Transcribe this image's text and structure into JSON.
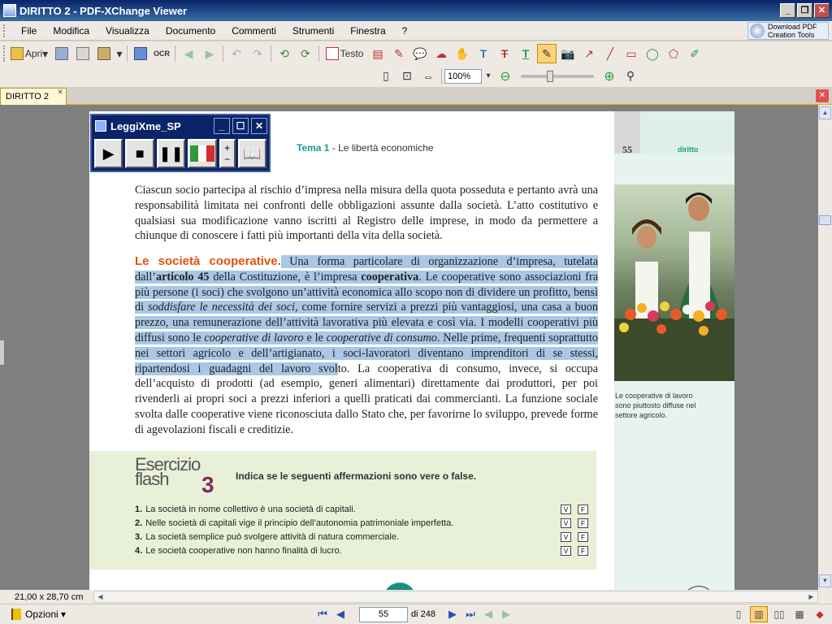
{
  "window": {
    "title": "DIRITTO 2 - PDF-XChange Viewer"
  },
  "menu": [
    "File",
    "Modifica",
    "Visualizza",
    "Documento",
    "Commenti",
    "Strumenti",
    "Finestra",
    "?"
  ],
  "download_tools": {
    "line1": "Download PDF",
    "line2": "Creation Tools"
  },
  "toolbar": {
    "open_label": "Apri",
    "text_label": "Testo",
    "ocr_label": "OCR",
    "zoom_value": "100%"
  },
  "tab": {
    "label": "DIRITTO 2",
    "close": "✕"
  },
  "leggixme": {
    "title": "LeggiXme_SP"
  },
  "page": {
    "header_tema": "Tema 1",
    "header_rest": " - Le libertà economiche",
    "number": "55",
    "subject": "diritto",
    "para1": "Ciascun socio partecipa al rischio d’impresa nella misura della quota posseduta e pertanto avrà una responsabilità limitata nei confronti delle obbligazioni assunte dalla società. L’atto costitutivo e qualsiasi sua modificazione vanno iscritti al Registro delle imprese, in modo da permettere a chiunque di conoscere i fatti più importanti della vita della società.",
    "section_title": "Le società cooperative.",
    "hl_a": " Una forma particolare di organizzazione d’impresa, tutelata dall’",
    "hl_b": "articolo 45",
    "hl_c": " della Costituzione, è l’impresa ",
    "hl_d": "cooperativa",
    "hl_e": ". Le cooperative sono associazioni fra più persone (i soci) che svolgono un’attività economica allo scopo non di dividere un profitto, bensì di ",
    "hl_f": "soddisfare le necessità dei soci",
    "hl_g": ", come fornire servizi a prezzi più vantaggiosi, una casa a buon prezzo, una remunerazione dell’attività lavorativa più elevata e così via. I modelli cooperativi più diffusi sono le ",
    "hl_h": "cooperative di lavoro",
    "hl_i": " e le ",
    "hl_j": "cooperative di consumo",
    "hl_k": ". Nelle prime, frequenti soprattutto nei settori agricolo e dell’artigianato, i soci-lavoratori diventano imprenditori di se stessi, ripartendosi i guadagni del lavoro svol",
    "rest": "to. La cooperativa di consumo, invece, si occupa dell’acquisto di prodotti (ad esempio, generi alimentari) direttamente dai produttori, per poi rivenderli ai propri soci a prezzi inferiori a quelli praticati dai commercianti. La funzione sociale svolta dalle cooperative viene riconosciuta dallo Stato che, per favorirne lo sviluppo, prevede forme di agevolazioni fiscali e creditizie.",
    "caption": "Le cooperative di lavoro sono piuttosto diffuse nel settore agricolo."
  },
  "exercise": {
    "title_line1": "Esercizio",
    "title_line2": "flash",
    "number": "3",
    "instruction": "Indica se le seguenti affermazioni sono vere o false.",
    "items": [
      {
        "n": "1.",
        "text": "La società in nome collettivo è una società di capitali."
      },
      {
        "n": "2.",
        "text": "Nelle società di capitali vige il principio dell’autonomia patrimoniale imperfetta."
      },
      {
        "n": "3.",
        "text": "La società semplice può svolgere attività di natura commerciale."
      },
      {
        "n": "4.",
        "text": "Le società cooperative non hanno finalità di lucro."
      }
    ],
    "v": "V",
    "f": "F"
  },
  "status": {
    "page_size": "21,00 x 28,70 cm",
    "options_label": "Opzioni",
    "current_page": "55",
    "total_pages": "di 248"
  }
}
